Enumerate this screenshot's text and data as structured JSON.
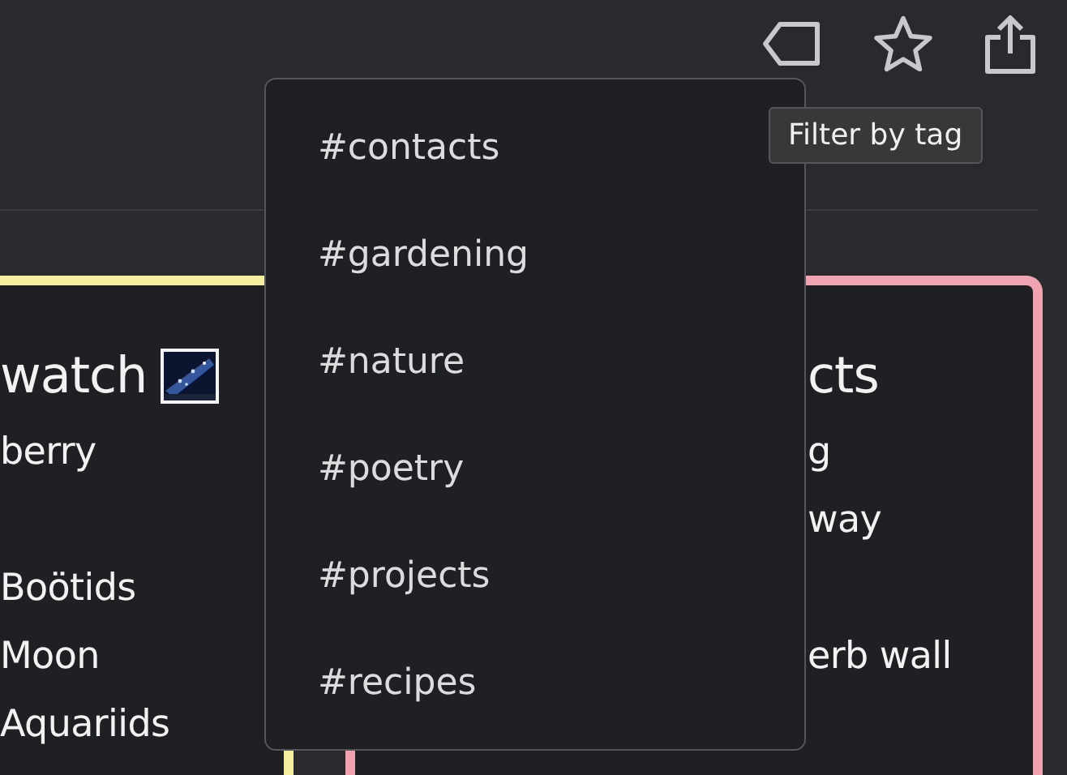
{
  "tooltip": {
    "text": "Filter by tag"
  },
  "tag_menu": {
    "items": [
      {
        "label": "#contacts"
      },
      {
        "label": "#gardening"
      },
      {
        "label": "#nature"
      },
      {
        "label": "#poetry"
      },
      {
        "label": "#projects"
      },
      {
        "label": "#recipes"
      }
    ]
  },
  "notes": [
    {
      "title": "watch",
      "title_icon": true,
      "color": "#f5ee9e",
      "paragraphs": [
        [
          "berry"
        ],
        [
          "Boötids",
          "Moon",
          "Aquariids"
        ]
      ]
    },
    {
      "title": "cts",
      "title_icon": false,
      "color": "#f0a3b1",
      "paragraphs": [
        [
          "g",
          "way"
        ],
        [
          "erb wall"
        ]
      ]
    }
  ]
}
